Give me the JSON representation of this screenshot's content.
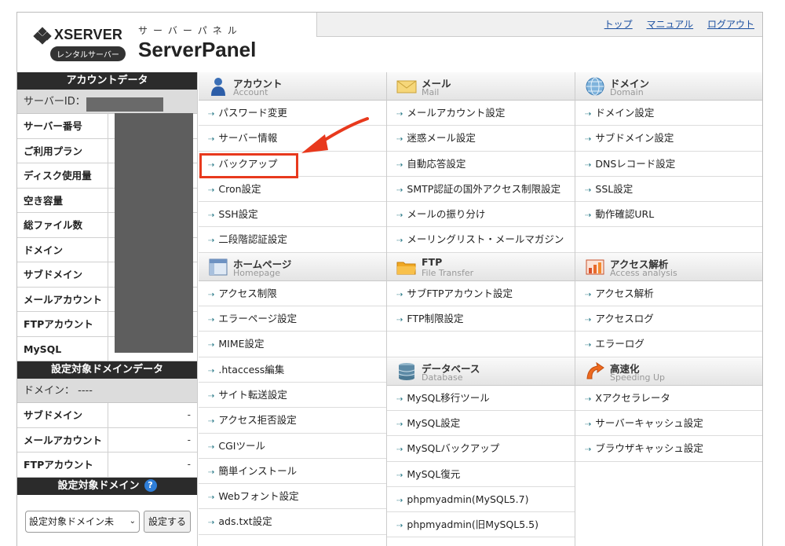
{
  "header": {
    "brand": "XSERVER",
    "brand_badge": "レンタルサーバー",
    "panel_kana": "サーバーパネル",
    "panel_name": "ServerPanel",
    "links": [
      "トップ",
      "マニュアル",
      "ログアウト"
    ]
  },
  "sidebar": {
    "account_title": "アカウントデータ",
    "server_id_label": "サーバーID：",
    "account_rows": [
      "サーバー番号",
      "ご利用プラン",
      "ディスク使用量",
      "空き容量",
      "総ファイル数",
      "ドメイン",
      "サブドメイン",
      "メールアカウント",
      "FTPアカウント",
      "MySQL"
    ],
    "domain_data_title": "設定対象ドメインデータ",
    "domain_label": "ドメイン： ----",
    "domain_rows": [
      {
        "label": "サブドメイン",
        "value": "-"
      },
      {
        "label": "メールアカウント",
        "value": "-"
      },
      {
        "label": "FTPアカウント",
        "value": "-"
      }
    ],
    "target_domain_title": "設定対象ドメイン",
    "select_value": "設定対象ドメイン未",
    "set_button": "設定する"
  },
  "sections": {
    "account": {
      "jp": "アカウント",
      "en": "Account",
      "items": [
        "パスワード変更",
        "サーバー情報",
        "バックアップ",
        "Cron設定",
        "SSH設定",
        "二段階認証設定"
      ]
    },
    "mail": {
      "jp": "メール",
      "en": "Mail",
      "items": [
        "メールアカウント設定",
        "迷惑メール設定",
        "自動応答設定",
        "SMTP認証の国外アクセス制限設定",
        "メールの振り分け",
        "メーリングリスト・メールマガジン"
      ]
    },
    "domain": {
      "jp": "ドメイン",
      "en": "Domain",
      "items": [
        "ドメイン設定",
        "サブドメイン設定",
        "DNSレコード設定",
        "SSL設定",
        "動作確認URL"
      ]
    },
    "homepage": {
      "jp": "ホームページ",
      "en": "Homepage",
      "items": [
        "アクセス制限",
        "エラーページ設定",
        "MIME設定",
        ".htaccess編集",
        "サイト転送設定",
        "アクセス拒否設定",
        "CGIツール",
        "簡単インストール",
        "Webフォント設定",
        "ads.txt設定"
      ]
    },
    "ftp": {
      "jp": "FTP",
      "en": "File Transfer",
      "items": [
        "サブFTPアカウント設定",
        "FTP制限設定"
      ]
    },
    "access": {
      "jp": "アクセス解析",
      "en": "Access analysis",
      "items": [
        "アクセス解析",
        "アクセスログ",
        "エラーログ"
      ]
    },
    "database": {
      "jp": "データベース",
      "en": "Database",
      "items": [
        "MySQL移行ツール",
        "MySQL設定",
        "MySQLバックアップ",
        "MySQL復元",
        "phpmyadmin(MySQL5.7)",
        "phpmyadmin(旧MySQL5.5)"
      ]
    },
    "speed": {
      "jp": "高速化",
      "en": "Speeding Up",
      "items": [
        "Xアクセラレータ",
        "サーバーキャッシュ設定",
        "ブラウザキャッシュ設定"
      ]
    }
  },
  "colors": {
    "annotation": "#e8391d",
    "link": "#1a4fa0",
    "sidebar_head": "#2b2b2b"
  }
}
